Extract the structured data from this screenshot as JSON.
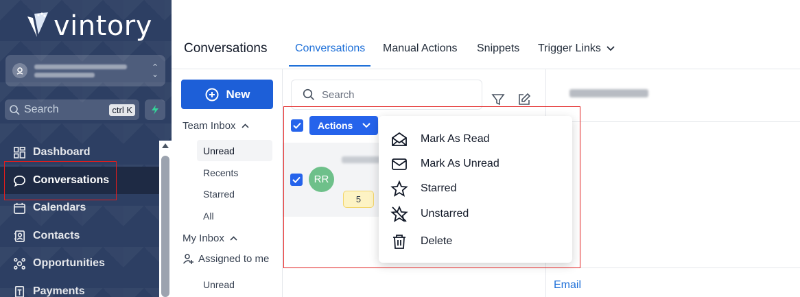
{
  "brand": {
    "name": "vintory"
  },
  "sidebar": {
    "search_placeholder": "Search",
    "search_shortcut": "ctrl K",
    "items": [
      {
        "label": "Dashboard",
        "icon": "dashboard-icon"
      },
      {
        "label": "Conversations",
        "icon": "chat-bubble-icon"
      },
      {
        "label": "Calendars",
        "icon": "calendar-icon"
      },
      {
        "label": "Contacts",
        "icon": "contacts-icon"
      },
      {
        "label": "Opportunities",
        "icon": "opportunities-icon"
      },
      {
        "label": "Payments",
        "icon": "payments-icon"
      }
    ]
  },
  "header": {
    "title": "Conversations",
    "tabs": [
      {
        "label": "Conversations"
      },
      {
        "label": "Manual Actions"
      },
      {
        "label": "Snippets"
      },
      {
        "label": "Trigger Links"
      }
    ]
  },
  "inbox": {
    "new_label": "New",
    "team_inbox": "Team Inbox",
    "team_filters": [
      "Unread",
      "Recents",
      "Starred",
      "All"
    ],
    "my_inbox": "My Inbox",
    "assigned_to_me": "Assigned to me",
    "my_filters": [
      "Unread"
    ]
  },
  "list": {
    "search_placeholder": "Search",
    "actions_label": "Actions",
    "conversation": {
      "initials": "RR",
      "count": "5"
    }
  },
  "actions_menu": {
    "items": [
      {
        "label": "Mark As Read",
        "icon": "envelope-open-icon"
      },
      {
        "label": "Mark As Unread",
        "icon": "envelope-icon"
      },
      {
        "label": "Starred",
        "icon": "star-icon"
      },
      {
        "label": "Unstarred",
        "icon": "star-off-icon"
      },
      {
        "label": "Delete",
        "icon": "trash-icon"
      }
    ]
  },
  "details": {
    "email_label": "Email"
  },
  "colors": {
    "sidebar_bg": "#2d3f63",
    "accent": "#1d6fd8",
    "primary_button": "#1d5fd8",
    "avatar": "#6ec08a",
    "highlight_box": "#e11d1d"
  }
}
